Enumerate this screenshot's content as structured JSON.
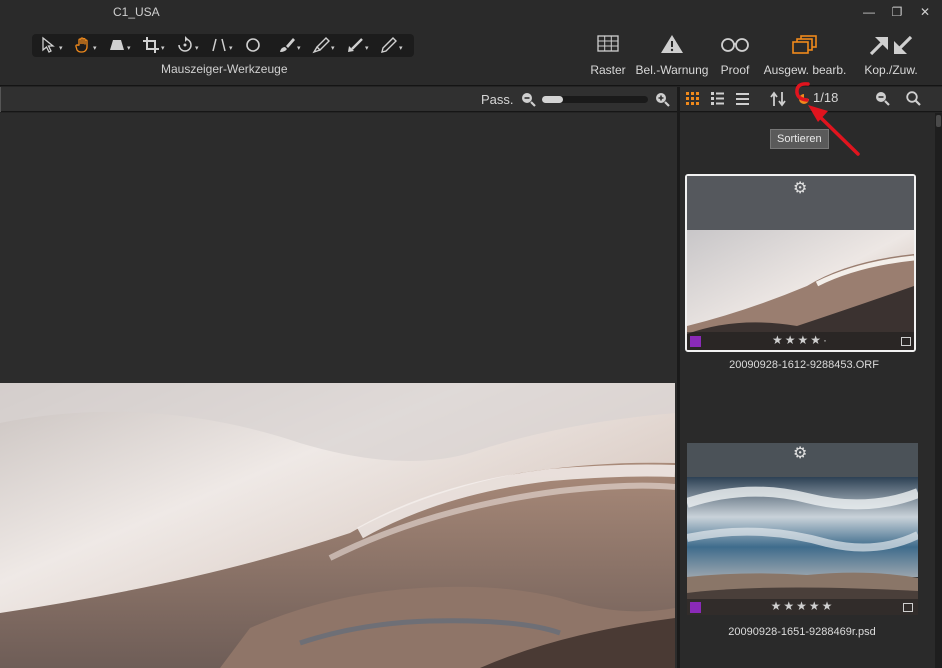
{
  "window": {
    "title": "C1_USA",
    "controls": {
      "minimize": "—",
      "maximize": "❐",
      "close": "✕"
    }
  },
  "toolbar": {
    "cursor_caption": "Mauszeiger-Werkzeuge",
    "cursor_tools": [
      "select-arrow",
      "pan-hand",
      "keystone",
      "crop",
      "rotate",
      "straighten",
      "spot-remove",
      "brush",
      "eraser",
      "gradient",
      "annotate"
    ],
    "right_tools": [
      {
        "id": "raster",
        "label": "Raster"
      },
      {
        "id": "warning",
        "label": "Bel.-Warnung"
      },
      {
        "id": "proof",
        "label": "Proof"
      },
      {
        "id": "edit-selected",
        "label": "Ausgew. bearb."
      },
      {
        "id": "copy-apply",
        "label": "Kop./Zuw."
      }
    ]
  },
  "viewer": {
    "zoom_label": "Pass.",
    "zoom_level": 0.2
  },
  "browser": {
    "count": "1/18",
    "tooltip": "Sortieren",
    "thumbnails": [
      {
        "filename": "20090928-1612-9288453.ORF",
        "rating": 4,
        "max_rating": 5,
        "selected": true,
        "color_label": "#8a2ab8"
      },
      {
        "filename": "20090928-1651-9288469r.psd",
        "rating": 5,
        "max_rating": 5,
        "selected": false,
        "color_label": "#8a2ab8"
      }
    ]
  },
  "colors": {
    "accent": "#f08a1c",
    "annotation": "#e0141e",
    "selected_border": "#f2f2f2"
  }
}
